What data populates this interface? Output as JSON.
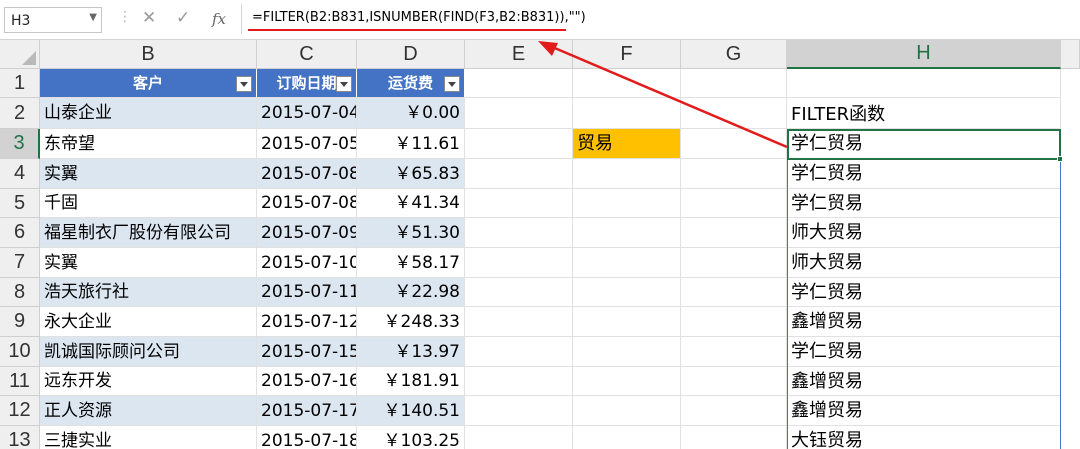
{
  "formula_bar": {
    "name_box": "H3",
    "cancel_icon": "cancel-icon",
    "enter_icon": "check-icon",
    "fx_label": "fx",
    "formula": "=FILTER(B2:B831,ISNUMBER(FIND(F3,B2:B831)),\"\")"
  },
  "columns": [
    "B",
    "C",
    "D",
    "E",
    "F",
    "G",
    "H"
  ],
  "rows": [
    "1",
    "2",
    "3",
    "4",
    "5",
    "6",
    "7",
    "8",
    "9",
    "10",
    "11",
    "12",
    "13"
  ],
  "table": {
    "headers": [
      "客户",
      "订购日期",
      "运货费"
    ],
    "records": [
      [
        "山泰企业",
        "2015-07-04",
        "￥0.00"
      ],
      [
        "东帝望",
        "2015-07-05",
        "￥11.61"
      ],
      [
        "实翼",
        "2015-07-08",
        "￥65.83"
      ],
      [
        "千固",
        "2015-07-08",
        "￥41.34"
      ],
      [
        "福星制衣厂股份有限公司",
        "2015-07-09",
        "￥51.30"
      ],
      [
        "实翼",
        "2015-07-10",
        "￥58.17"
      ],
      [
        "浩天旅行社",
        "2015-07-11",
        "￥22.98"
      ],
      [
        "永大企业",
        "2015-07-12",
        "￥248.33"
      ],
      [
        "凯诚国际顾问公司",
        "2015-07-15",
        "￥13.97"
      ],
      [
        "远东开发",
        "2015-07-16",
        "￥181.91"
      ],
      [
        "正人资源",
        "2015-07-17",
        "￥140.51"
      ],
      [
        "三捷实业",
        "2015-07-18",
        "￥103.25"
      ]
    ]
  },
  "criteria": {
    "value": "贸易",
    "fill_color": "#FFC000"
  },
  "filter_result": {
    "header": "FILTER函数",
    "values": [
      "学仁贸易",
      "学仁贸易",
      "学仁贸易",
      "师大贸易",
      "师大贸易",
      "学仁贸易",
      "鑫增贸易",
      "学仁贸易",
      "鑫增贸易",
      "鑫增贸易",
      "大钰贸易"
    ]
  },
  "colors": {
    "table_header": "#4472C4",
    "band_fill": "#DCE6F1",
    "selection": "#217346",
    "annotation": "#E21B1B"
  }
}
